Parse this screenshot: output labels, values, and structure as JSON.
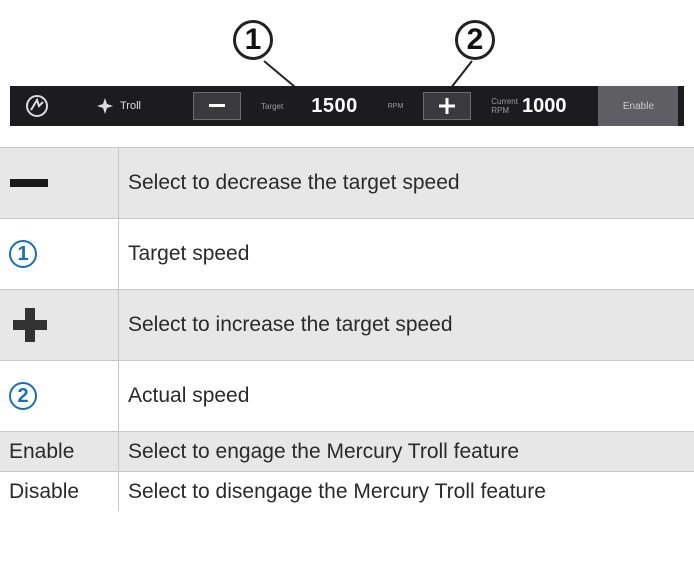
{
  "toolbar": {
    "mode_label": "Troll",
    "target_label": "Target",
    "target_value": "1500",
    "target_unit": "RPM",
    "current_label_line1": "Current",
    "current_label_line2": "RPM",
    "current_value": "1000",
    "enable_label": "Enable"
  },
  "callouts": {
    "one": "1",
    "two": "2"
  },
  "legend": {
    "rows": [
      {
        "symbol": "minus-icon",
        "description": "Select to decrease the target speed"
      },
      {
        "symbol": "1",
        "description": "Target speed"
      },
      {
        "symbol": "plus-icon",
        "description": "Select to increase the target speed"
      },
      {
        "symbol": "2",
        "description": "Actual speed"
      },
      {
        "symbol": "Enable",
        "description": "Select to engage the Mercury Troll feature"
      },
      {
        "symbol": "Disable",
        "description": "Select to disengage the Mercury Troll feature"
      }
    ]
  },
  "colors": {
    "toolbar_bg": "#1c1c1e",
    "callout_blue": "#1a6fb5",
    "row_shade": "#e7e7e7"
  }
}
